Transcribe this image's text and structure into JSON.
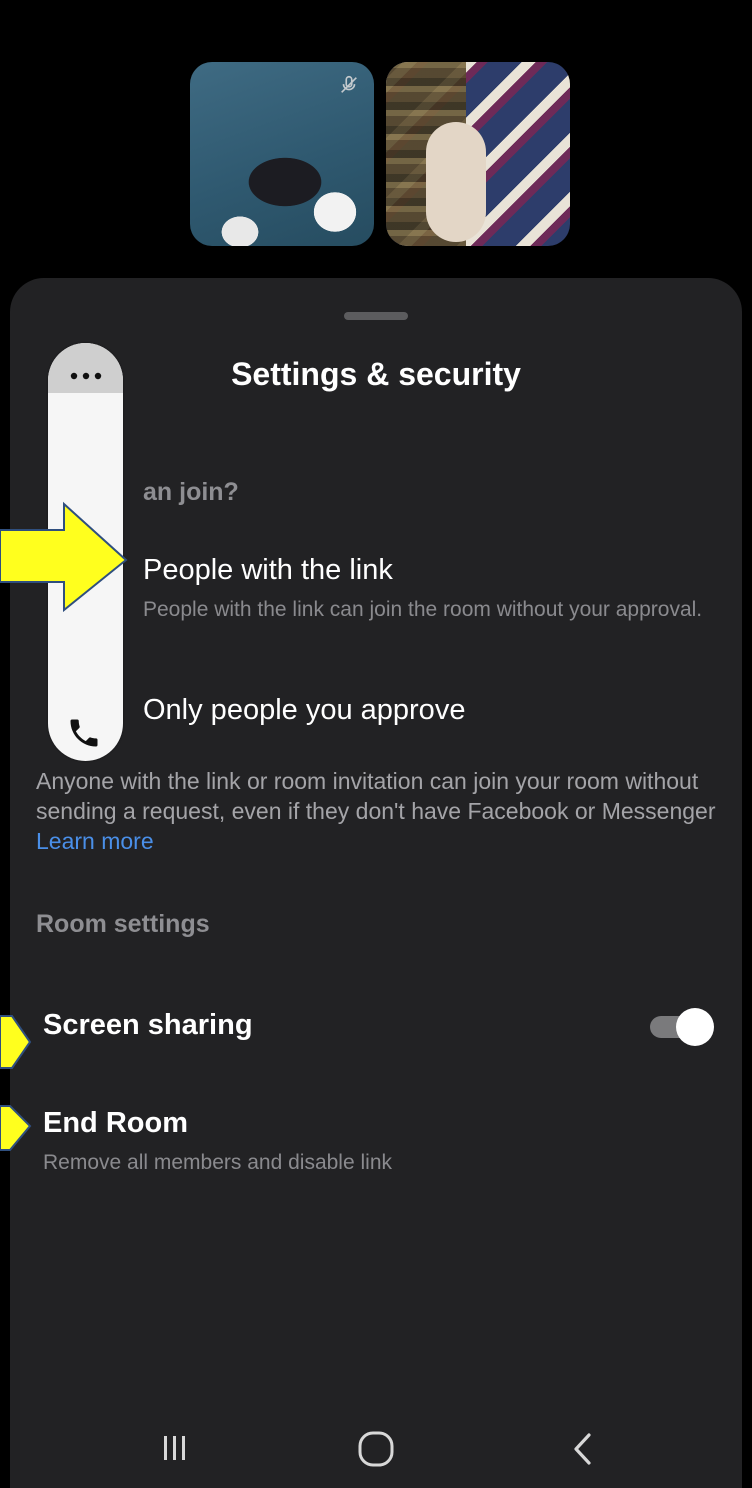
{
  "sheet": {
    "title": "Settings & security"
  },
  "who_can_join": {
    "label": "an join?",
    "options": [
      {
        "title": "People with the link",
        "description": "People with the link can join the room without your approval."
      },
      {
        "title": "Only people you approve"
      }
    ],
    "info_text": "Anyone with the link or room invitation can join your room without sending a request, even if they don't have Facebook or Messenger",
    "learn_more": "Learn more"
  },
  "room_settings": {
    "label": "Room settings",
    "screen_sharing": {
      "label": "Screen sharing",
      "enabled": true
    },
    "end_room": {
      "label": "End Room",
      "description": "Remove all members and disable link"
    }
  },
  "colors": {
    "sheet_bg": "#222224",
    "link": "#4a8fe8",
    "arrow_fill": "#ffff1e",
    "arrow_stroke": "#2f4f7f"
  },
  "icons": {
    "more": "more-horizontal-icon",
    "call": "phone-icon",
    "mic": "mic-off-icon",
    "nav_recent": "recent-apps-icon",
    "nav_home": "home-icon",
    "nav_back": "back-icon"
  }
}
